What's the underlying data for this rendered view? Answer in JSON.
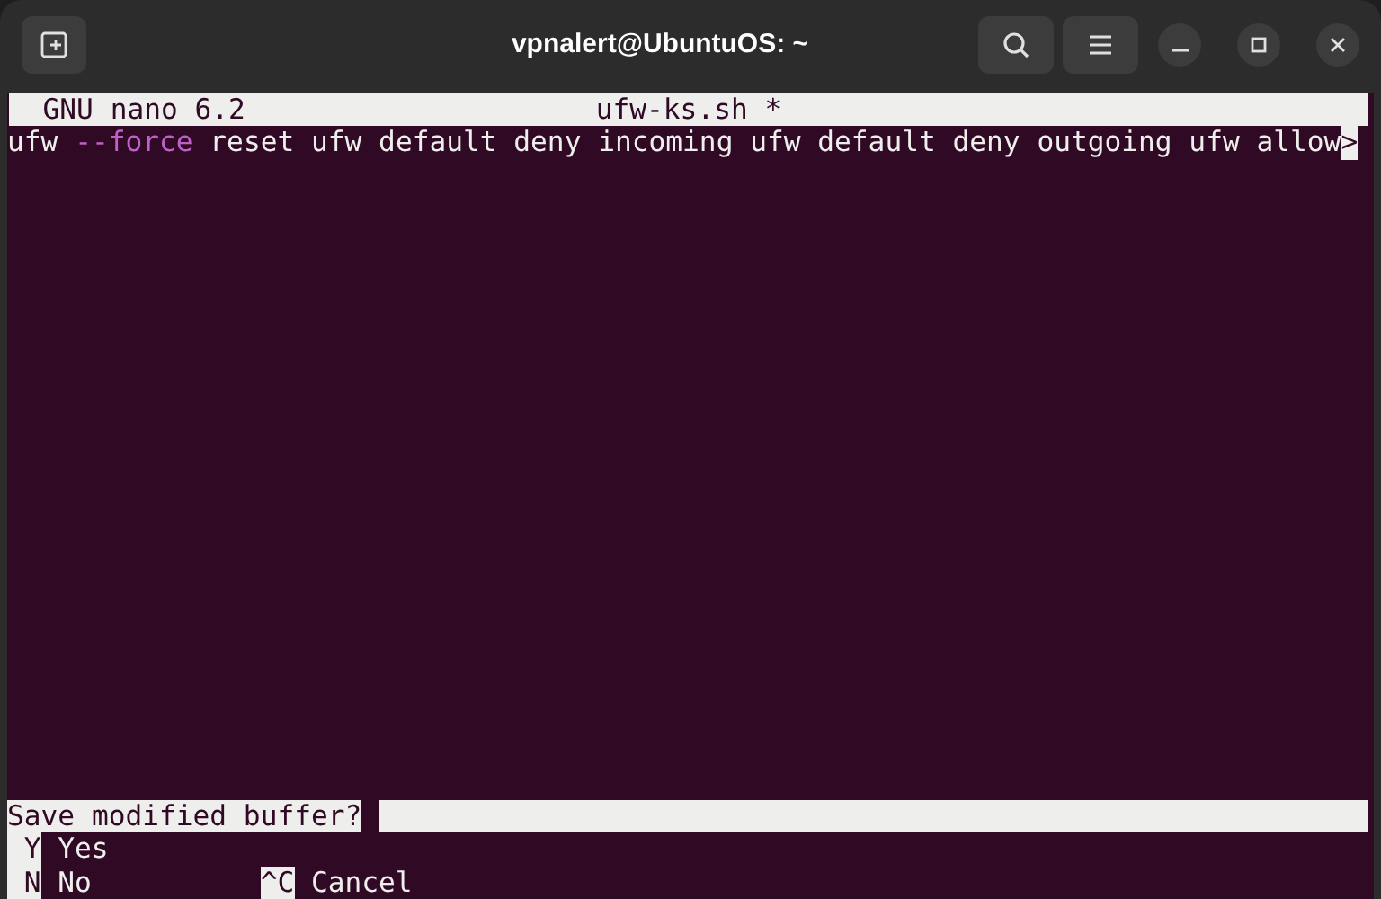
{
  "window": {
    "title": "vpnalert@UbuntuOS: ~"
  },
  "nano": {
    "version": "GNU nano 6.2",
    "filename": "ufw-ks.sh",
    "modified_flag": "*",
    "lines": [
      {
        "segments": [
          {
            "text": "ufw ",
            "kind": "plain"
          },
          {
            "text": "--force",
            "kind": "option"
          },
          {
            "text": " reset ufw default deny incoming ufw default deny outgoing ufw allow",
            "kind": "plain"
          }
        ],
        "overflow_marker": ">"
      }
    ],
    "prompt": {
      "label": "Save modified buffer?"
    },
    "shortcut_rows": [
      [
        {
          "key": "Y",
          "label": "Yes"
        }
      ],
      [
        {
          "key": "N",
          "label": "No"
        },
        {
          "key": "^C",
          "label": "Cancel"
        }
      ]
    ]
  }
}
